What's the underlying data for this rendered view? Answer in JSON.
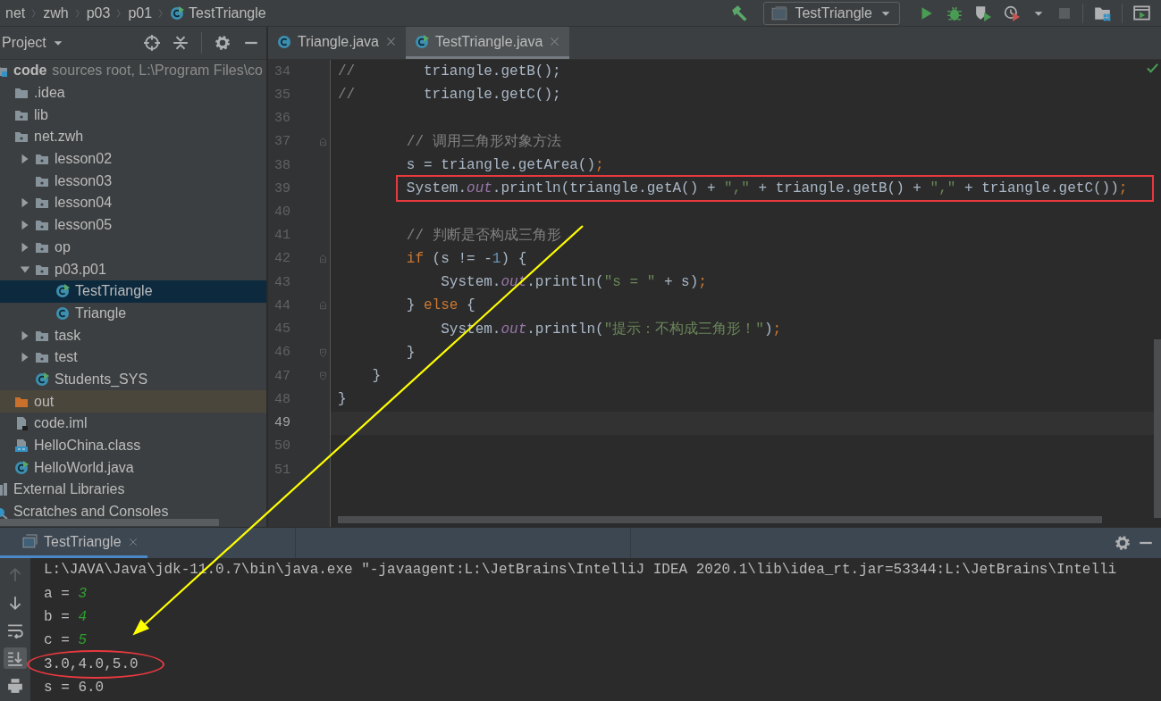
{
  "breadcrumbs": [
    {
      "label": "net",
      "kind": "package"
    },
    {
      "label": "zwh",
      "kind": "package"
    },
    {
      "label": "p03",
      "kind": "package"
    },
    {
      "label": "p01",
      "kind": "package"
    },
    {
      "label": "TestTriangle",
      "kind": "class-run"
    }
  ],
  "toolbar": [
    {
      "kind": "build",
      "disabled": false
    },
    {
      "kind": "run-config",
      "label": "TestTriangle",
      "disabled": false
    },
    {
      "kind": "run",
      "disabled": false
    },
    {
      "kind": "debug",
      "disabled": false
    },
    {
      "kind": "coverage",
      "disabled": false
    },
    {
      "kind": "profile",
      "disabled": false
    },
    {
      "kind": "stop",
      "disabled": true
    },
    {
      "kind": "project-structure",
      "disabled": false
    },
    {
      "kind": "run-window",
      "disabled": false
    }
  ],
  "project_panel": {
    "title": "Project"
  },
  "tree": [
    {
      "label": "code",
      "hint": "sources root,  L:\\Program Files\\co",
      "kind": "module",
      "selected": false,
      "children": [
        {
          "label": ".idea",
          "kind": "folder",
          "selected": false
        },
        {
          "label": "lib",
          "kind": "package",
          "selected": false
        },
        {
          "label": "net.zwh",
          "kind": "package",
          "selected": false,
          "children": [
            {
              "label": "lesson02",
              "kind": "package",
              "selected": false,
              "expanded": false
            },
            {
              "label": "lesson03",
              "kind": "package",
              "selected": false
            },
            {
              "label": "lesson04",
              "kind": "package",
              "selected": false,
              "expanded": false
            },
            {
              "label": "lesson05",
              "kind": "package",
              "selected": false,
              "expanded": false
            },
            {
              "label": "op",
              "kind": "package",
              "selected": false,
              "expanded": false
            },
            {
              "label": "p03.p01",
              "kind": "package",
              "selected": false,
              "expanded": true,
              "children": [
                {
                  "label": "TestTriangle",
                  "kind": "class-run",
                  "selected": true
                },
                {
                  "label": "Triangle",
                  "kind": "class",
                  "selected": false
                }
              ]
            },
            {
              "label": "task",
              "kind": "package",
              "selected": false,
              "expanded": false
            },
            {
              "label": "test",
              "kind": "package",
              "selected": false,
              "expanded": false
            },
            {
              "label": "Students_SYS",
              "kind": "class-run",
              "selected": false
            }
          ]
        },
        {
          "label": "out",
          "kind": "excluded",
          "selected": false
        },
        {
          "label": "code.iml",
          "kind": "iml",
          "selected": false
        },
        {
          "label": "HelloChina.class",
          "kind": "classfile",
          "selected": false
        },
        {
          "label": "HelloWorld.java",
          "kind": "class-run",
          "selected": false
        }
      ]
    },
    {
      "label": "External Libraries",
      "kind": "library",
      "selected": false
    },
    {
      "label": "Scratches and Consoles",
      "kind": "scratches",
      "selected": false
    }
  ],
  "editor_tabs": [
    {
      "label": "Triangle.java",
      "kind": "class",
      "selected": false
    },
    {
      "label": "TestTriangle.java",
      "kind": "class-run",
      "selected": true
    }
  ],
  "code_lines": [
    {
      "number": "34",
      "current": false,
      "tokens": [
        {
          "kind": "comment",
          "text": "//"
        },
        {
          "kind": "plain",
          "text": "        triangle.getB();"
        }
      ]
    },
    {
      "number": "35",
      "current": false,
      "tokens": [
        {
          "kind": "comment",
          "text": "//"
        },
        {
          "kind": "plain",
          "text": "        triangle.getC();"
        }
      ]
    },
    {
      "number": "36",
      "current": false
    },
    {
      "number": "37",
      "current": false,
      "fold_start": true,
      "tokens": [
        {
          "kind": "comment",
          "text": "        // 调用三角形对象方法"
        }
      ]
    },
    {
      "number": "38",
      "current": false,
      "tokens": [
        {
          "kind": "plain",
          "text": "        s = triangle.getArea()"
        },
        {
          "kind": "semi",
          "text": ";"
        }
      ]
    },
    {
      "number": "39",
      "current": false,
      "boxed": true,
      "tokens": [
        {
          "kind": "plain",
          "text": "        System."
        },
        {
          "kind": "field",
          "text": "out"
        },
        {
          "kind": "plain",
          "text": ".println(triangle.getA() + "
        },
        {
          "kind": "string",
          "text": "\",\""
        },
        {
          "kind": "plain",
          "text": " + triangle.getB() + "
        },
        {
          "kind": "string",
          "text": "\",\""
        },
        {
          "kind": "plain",
          "text": " + triangle.getC())"
        },
        {
          "kind": "semi",
          "text": ";"
        }
      ]
    },
    {
      "number": "40",
      "current": false
    },
    {
      "number": "41",
      "current": false,
      "tokens": [
        {
          "kind": "comment",
          "text": "        // 判断是否构成三角形"
        }
      ]
    },
    {
      "number": "42",
      "current": false,
      "fold_start": true,
      "tokens": [
        {
          "kind": "keyword",
          "text": "        if"
        },
        {
          "kind": "plain",
          "text": " (s != -"
        },
        {
          "kind": "number",
          "text": "1"
        },
        {
          "kind": "plain",
          "text": ") {"
        }
      ]
    },
    {
      "number": "43",
      "current": false,
      "tokens": [
        {
          "kind": "plain",
          "text": "            System."
        },
        {
          "kind": "field",
          "text": "out"
        },
        {
          "kind": "plain",
          "text": ".println("
        },
        {
          "kind": "string",
          "text": "\"s = \""
        },
        {
          "kind": "plain",
          "text": " + s)"
        },
        {
          "kind": "semi",
          "text": ";"
        }
      ]
    },
    {
      "number": "44",
      "current": false,
      "fold_start": true,
      "tokens": [
        {
          "kind": "plain",
          "text": "        } "
        },
        {
          "kind": "keyword",
          "text": "else"
        },
        {
          "kind": "plain",
          "text": " {"
        }
      ]
    },
    {
      "number": "45",
      "current": false,
      "tokens": [
        {
          "kind": "plain",
          "text": "            System."
        },
        {
          "kind": "field",
          "text": "out"
        },
        {
          "kind": "plain",
          "text": ".println("
        },
        {
          "kind": "string",
          "text": "\"提示：不构成三角形！\""
        },
        {
          "kind": "plain",
          "text": ")"
        },
        {
          "kind": "semi",
          "text": ";"
        }
      ]
    },
    {
      "number": "46",
      "current": false,
      "fold_end": true,
      "tokens": [
        {
          "kind": "plain",
          "text": "        }"
        }
      ]
    },
    {
      "number": "47",
      "current": false,
      "fold_end": true,
      "tokens": [
        {
          "kind": "plain",
          "text": "    }"
        }
      ]
    },
    {
      "number": "48",
      "current": false,
      "tokens": [
        {
          "kind": "plain",
          "text": "}"
        }
      ]
    },
    {
      "number": "49",
      "current": true
    },
    {
      "number": "50",
      "current": false
    },
    {
      "number": "51",
      "current": false
    }
  ],
  "run_panel": {
    "tabs": [
      {
        "label": "TestTriangle",
        "selected": true
      }
    ],
    "toolbar": [
      {
        "kind": "up",
        "disabled": true,
        "on": false
      },
      {
        "kind": "down",
        "disabled": false,
        "on": false
      },
      {
        "kind": "wrap",
        "disabled": false,
        "on": false
      },
      {
        "kind": "scroll-end",
        "disabled": false,
        "on": true
      },
      {
        "kind": "print",
        "disabled": false,
        "on": false
      }
    ],
    "lines": [
      {
        "tokens": [
          {
            "kind": "plain",
            "text": "L:\\JAVA\\Java\\jdk-11.0.7\\bin\\java.exe \"-javaagent:L:\\JetBrains\\IntelliJ IDEA 2020.1\\lib\\idea_rt.jar=53344:L:\\JetBrains\\Intelli"
          }
        ]
      },
      {
        "tokens": [
          {
            "kind": "plain",
            "text": "a = "
          },
          {
            "kind": "number",
            "text": "3"
          }
        ]
      },
      {
        "tokens": [
          {
            "kind": "plain",
            "text": "b = "
          },
          {
            "kind": "number",
            "text": "4"
          }
        ]
      },
      {
        "tokens": [
          {
            "kind": "plain",
            "text": "c = "
          },
          {
            "kind": "number",
            "text": "5"
          }
        ]
      },
      {
        "circled": true,
        "tokens": [
          {
            "kind": "plain",
            "text": "3.0,4.0,5.0"
          }
        ]
      },
      {
        "tokens": [
          {
            "kind": "plain",
            "text": "s = 6.0"
          }
        ]
      }
    ]
  },
  "markup": {
    "arrow": true
  }
}
